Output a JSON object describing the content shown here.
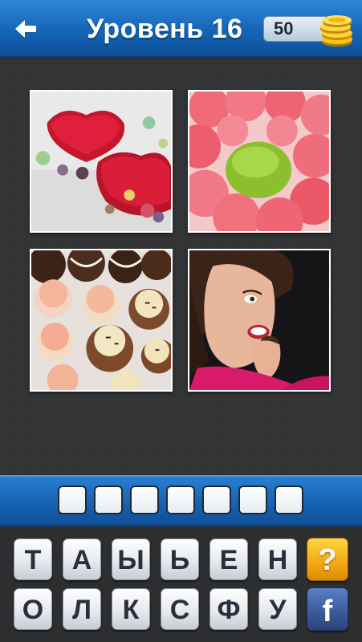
{
  "header": {
    "title": "Уровень 16",
    "coins": "50",
    "back_icon": "arrow-left-icon",
    "coin_icon": "coin-stack-icon"
  },
  "pictures": [
    {
      "name": "red-hearts-candy-photo"
    },
    {
      "name": "jelly-candies-photo"
    },
    {
      "name": "frosted-cookies-photo"
    },
    {
      "name": "woman-eating-chocolate-photo"
    }
  ],
  "answer": {
    "slots": [
      "",
      "",
      "",
      "",
      "",
      "",
      ""
    ]
  },
  "keyboard": {
    "row1": [
      "Т",
      "А",
      "Ы",
      "Ь",
      "Е",
      "Н"
    ],
    "row2": [
      "О",
      "Л",
      "К",
      "С",
      "Ф",
      "У"
    ],
    "hint_label": "?",
    "facebook_label": "f"
  },
  "colors": {
    "header_blue": "#1565b7",
    "hint_yellow": "#f3a812",
    "facebook_blue": "#3b5998"
  }
}
